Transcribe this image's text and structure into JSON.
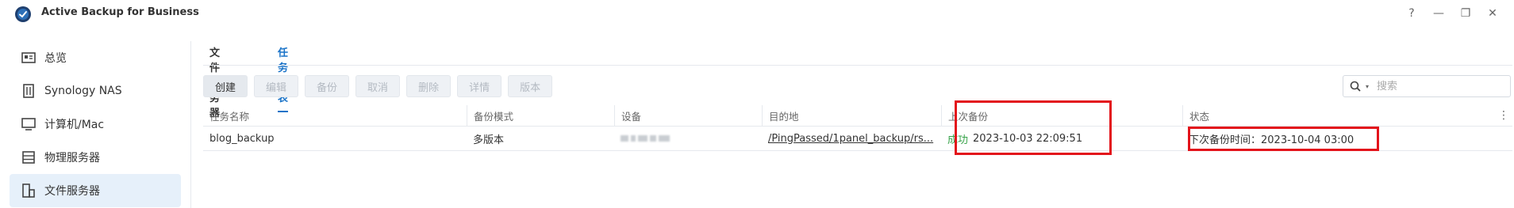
{
  "app": {
    "title": "Active Backup for Business"
  },
  "window_controls": {
    "help": "?",
    "minimize": "—",
    "restore": "❐",
    "close": "✕"
  },
  "sidebar": {
    "items": [
      {
        "label": "总览",
        "icon": "overview-icon"
      },
      {
        "label": "Synology NAS",
        "icon": "nas-icon"
      },
      {
        "label": "计算机/Mac",
        "icon": "computer-icon"
      },
      {
        "label": "物理服务器",
        "icon": "server-icon"
      },
      {
        "label": "文件服务器",
        "icon": "file-server-icon",
        "active": true
      }
    ]
  },
  "tabs": [
    {
      "label": "文件服务器"
    },
    {
      "label": "任务列表",
      "active": true
    }
  ],
  "toolbar": {
    "buttons": [
      {
        "label": "创建",
        "enabled": true
      },
      {
        "label": "编辑",
        "enabled": false
      },
      {
        "label": "备份",
        "enabled": false
      },
      {
        "label": "取消",
        "enabled": false
      },
      {
        "label": "删除",
        "enabled": false
      },
      {
        "label": "详情",
        "enabled": false
      },
      {
        "label": "版本",
        "enabled": false
      }
    ]
  },
  "search": {
    "placeholder": "搜索"
  },
  "table": {
    "columns": [
      "任务名称",
      "备份模式",
      "设备",
      "目的地",
      "上次备份",
      "状态"
    ],
    "rows": [
      {
        "task_name": "blog_backup",
        "backup_mode": "多版本",
        "destination": "/PingPassed/1panel_backup/rs...",
        "last_backup_status": "成功",
        "last_backup_time": "2023-10-03 22:09:51",
        "status": "下次备份时间：2023-10-04 03:00"
      }
    ]
  },
  "colors": {
    "accent": "#1a73c8",
    "success": "#38a34a",
    "highlight": "#e3131b"
  }
}
